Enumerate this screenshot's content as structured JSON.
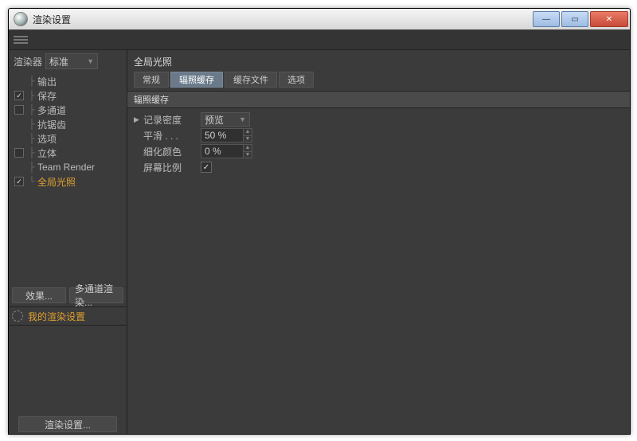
{
  "window": {
    "title": "渲染设置"
  },
  "sidebar": {
    "renderer_label": "渲染器",
    "renderer_value": "标准",
    "items": [
      {
        "label": "输出",
        "checked": null
      },
      {
        "label": "保存",
        "checked": true
      },
      {
        "label": "多通道",
        "checked": false
      },
      {
        "label": "抗锯齿",
        "checked": null
      },
      {
        "label": "选项",
        "checked": null
      },
      {
        "label": "立体",
        "checked": false
      },
      {
        "label": "Team Render",
        "checked": null
      },
      {
        "label": "全局光照",
        "checked": true,
        "active": true
      }
    ],
    "effects_btn": "效果...",
    "multipass_btn": "多通道渲染...",
    "preset_label": "我的渲染设置",
    "bottom_btn": "渲染设置..."
  },
  "main": {
    "title": "全局光照",
    "tabs": [
      {
        "label": "常规"
      },
      {
        "label": "辐照缓存",
        "active": true
      },
      {
        "label": "缓存文件"
      },
      {
        "label": "选项"
      }
    ],
    "section": "辐照缓存",
    "params": {
      "record_density": {
        "label": "记录密度",
        "value": "预览"
      },
      "smooth": {
        "label": "平滑 . . .",
        "value": "50 %"
      },
      "color_refine": {
        "label": "细化颜色",
        "value": "0 %"
      },
      "screen_ratio": {
        "label": "屏幕比例",
        "checked": true
      }
    }
  }
}
